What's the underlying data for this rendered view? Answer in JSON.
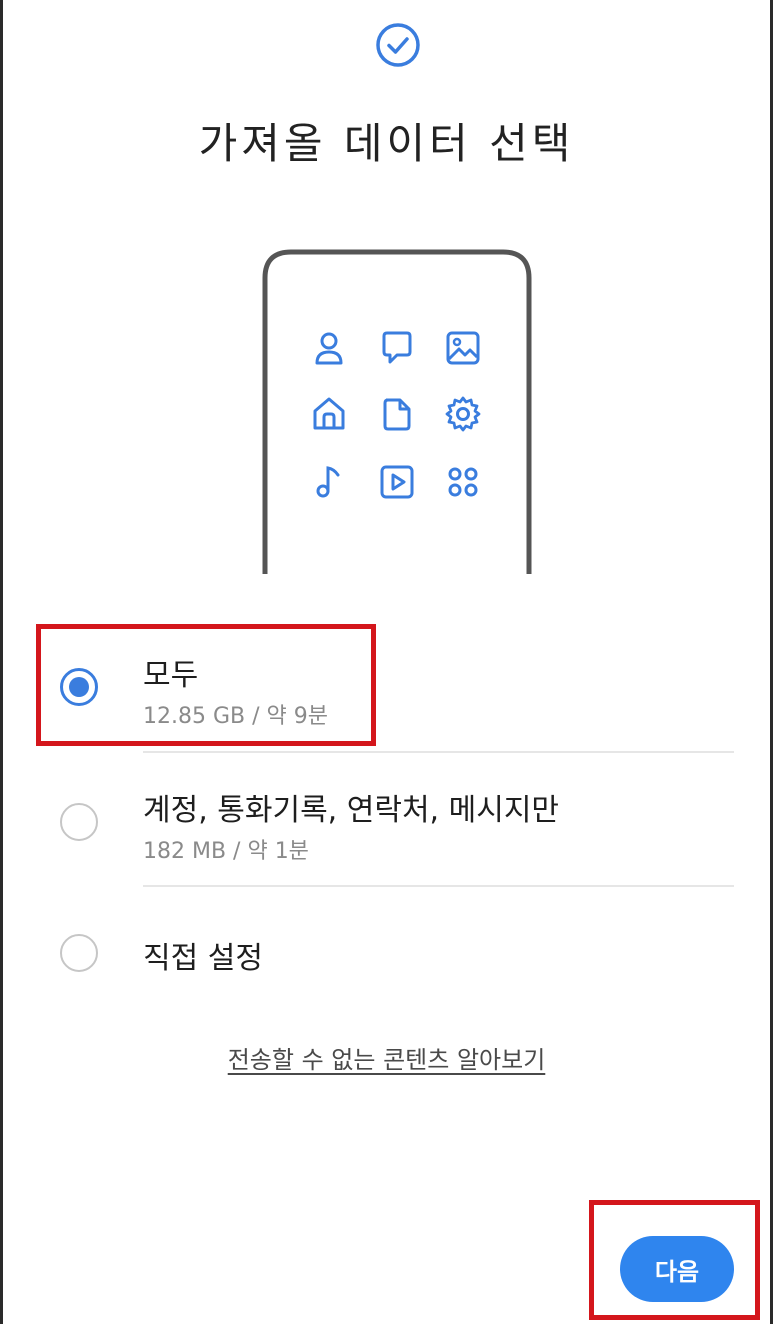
{
  "header": {
    "icon": "check-circle-icon",
    "title": "가져올 데이터 선택"
  },
  "illustration": {
    "icons": [
      "person-icon",
      "chat-icon",
      "image-icon",
      "home-icon",
      "document-icon",
      "settings-icon",
      "music-note-icon",
      "video-play-icon",
      "apps-grid-icon"
    ]
  },
  "options": [
    {
      "label": "모두",
      "sub": "12.85 GB / 약 9분",
      "selected": true
    },
    {
      "label": "계정, 통화기록, 연락처, 메시지만",
      "sub": "182 MB / 약 1분",
      "selected": false
    },
    {
      "label": "직접 설정",
      "sub": "",
      "selected": false
    }
  ],
  "info_link": "전송할 수 없는 콘텐츠 알아보기",
  "next_button": "다음",
  "colors": {
    "accent": "#3a7dde",
    "button": "#2f85ee",
    "highlight": "#d4161c"
  }
}
